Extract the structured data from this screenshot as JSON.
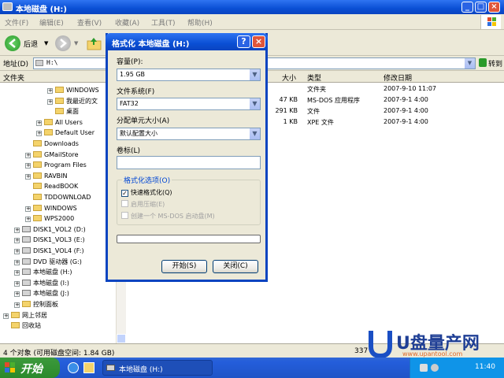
{
  "window": {
    "title": "本地磁盘 (H:)"
  },
  "menu": [
    "文件(F)",
    "编辑(E)",
    "查看(V)",
    "收藏(A)",
    "工具(T)",
    "帮助(H)"
  ],
  "toolbar": {
    "back_label": "后退"
  },
  "address": {
    "label": "地址(D)",
    "value": "H:\\",
    "go_label": "转到"
  },
  "left_panel": {
    "header": "文件夹",
    "items": [
      {
        "label": "WINDOWS",
        "indent": 4,
        "type": "folder",
        "expand": "+"
      },
      {
        "label": "我最近的文",
        "indent": 4,
        "type": "folder",
        "expand": "+"
      },
      {
        "label": "桌面",
        "indent": 4,
        "type": "folder",
        "expand": ""
      },
      {
        "label": "All Users",
        "indent": 3,
        "type": "folder",
        "expand": "+"
      },
      {
        "label": "Default User",
        "indent": 3,
        "type": "folder",
        "expand": "+"
      },
      {
        "label": "Downloads",
        "indent": 2,
        "type": "folder",
        "expand": ""
      },
      {
        "label": "GMailStore",
        "indent": 2,
        "type": "folder",
        "expand": "+"
      },
      {
        "label": "Program Files",
        "indent": 2,
        "type": "folder",
        "expand": "+"
      },
      {
        "label": "RAVBIN",
        "indent": 2,
        "type": "folder",
        "expand": "+"
      },
      {
        "label": "ReadBOOK",
        "indent": 2,
        "type": "folder",
        "expand": ""
      },
      {
        "label": "TDDOWNLOAD",
        "indent": 2,
        "type": "folder",
        "expand": ""
      },
      {
        "label": "WINDOWS",
        "indent": 2,
        "type": "folder",
        "expand": "+"
      },
      {
        "label": "WPS2000",
        "indent": 2,
        "type": "folder",
        "expand": "+"
      },
      {
        "label": "DISK1_VOL2 (D:)",
        "indent": 1,
        "type": "drive",
        "expand": "+"
      },
      {
        "label": "DISK1_VOL3 (E:)",
        "indent": 1,
        "type": "drive",
        "expand": "+"
      },
      {
        "label": "DISK1_VOL4 (F:)",
        "indent": 1,
        "type": "drive",
        "expand": "+"
      },
      {
        "label": "DVD 驱动器 (G:)",
        "indent": 1,
        "type": "drive",
        "expand": "+"
      },
      {
        "label": "本地磁盘 (H:)",
        "indent": 1,
        "type": "drive",
        "expand": "+"
      },
      {
        "label": "本地磁盘 (I:)",
        "indent": 1,
        "type": "drive",
        "expand": "+"
      },
      {
        "label": "本地磁盘 (J:)",
        "indent": 1,
        "type": "drive",
        "expand": "+"
      },
      {
        "label": "控制面板",
        "indent": 1,
        "type": "folder",
        "expand": "+"
      },
      {
        "label": "网上邻居",
        "indent": 0,
        "type": "folder",
        "expand": "+"
      },
      {
        "label": "回收站",
        "indent": 0,
        "type": "folder",
        "expand": ""
      }
    ]
  },
  "file_list": {
    "columns": {
      "size": "大小",
      "type": "类型",
      "modified": "修改日期"
    },
    "rows": [
      {
        "size": "",
        "type": "文件夹",
        "modified": "2007-9-10 11:07"
      },
      {
        "size": "47 KB",
        "type": "MS-DOS 应用程序",
        "modified": "2007-9-1 4:00"
      },
      {
        "size": "291 KB",
        "type": "文件",
        "modified": "2007-9-1 4:00"
      },
      {
        "size": "1 KB",
        "type": "XPE 文件",
        "modified": "2007-9-1 4:00"
      }
    ]
  },
  "status": {
    "text": "4 个对象 (可用磁盘空间: 1.84 GB)",
    "right": "337"
  },
  "taskbar": {
    "start_label": "开始",
    "task_label": "本地磁盘 (H:)",
    "clock": "11:40"
  },
  "dialog": {
    "title": "格式化 本地磁盘 (H:)",
    "capacity_label": "容量(P):",
    "capacity_value": "1.95 GB",
    "fs_label": "文件系统(F)",
    "fs_value": "FAT32",
    "alloc_label": "分配单元大小(A)",
    "alloc_value": "默认配置大小",
    "volume_label": "卷标(L)",
    "volume_value": "",
    "options_label": "格式化选项(O)",
    "quick_format": "快速格式化(Q)",
    "compression": "启用压缩(E)",
    "msdos_startup": "创建一个 MS-DOS 启动盘(M)",
    "start_button": "开始(S)",
    "close_button": "关闭(C)"
  },
  "watermark": {
    "brand": "U盘量产网",
    "url": "www.upantool.com"
  },
  "colors": {
    "xp_blue": "#0a4fd4",
    "start_green": "#2b8a2b",
    "window_bg": "#ece9d8"
  }
}
